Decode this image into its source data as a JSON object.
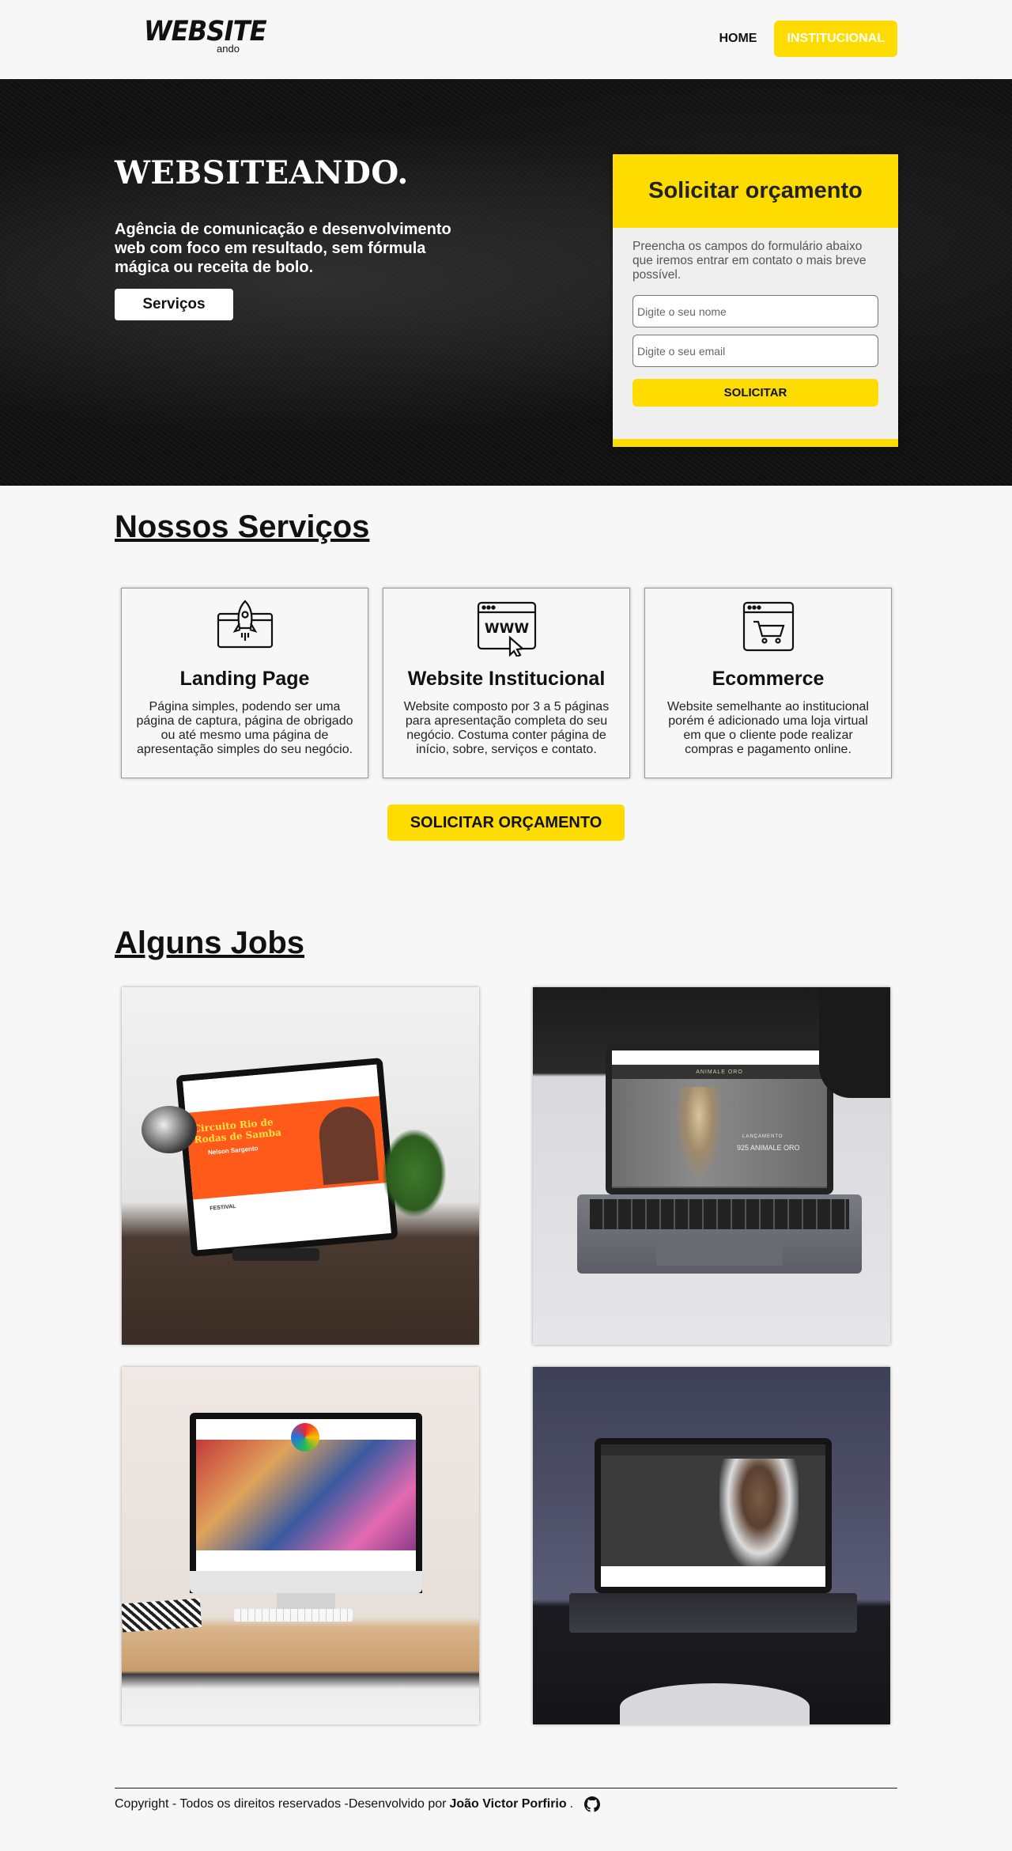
{
  "header": {
    "logo_main": "WEBSITE",
    "logo_sub": "ando",
    "nav": {
      "home": "HOME",
      "institucional": "INSTITUCIONAL"
    }
  },
  "hero": {
    "title": "WEBSITEANDO.",
    "text": "Agência de comunicação e desenvolvimento web com foco em resultado, sem fórmula mágica ou receita de bolo.",
    "button": "Serviços"
  },
  "quote_form": {
    "title": "Solicitar orçamento",
    "description": "Preencha os campos do formulário abaixo que iremos entrar em contato o mais breve possível.",
    "name_placeholder": "Digite o seu nome",
    "email_placeholder": "Digite o seu email",
    "submit": "SOLICITAR"
  },
  "services": {
    "title": "Nossos Serviços",
    "cards": [
      {
        "icon": "rocket-icon",
        "title": "Landing Page",
        "text": "Página simples, podendo ser uma página de captura, página de obrigado ou até mesmo uma página de apresentação simples do seu negócio."
      },
      {
        "icon": "www-browser-icon",
        "title": "Website Institucional",
        "text": "Website composto por 3 a 5 páginas para apresentação completa do seu negócio. Costuma conter página de início, sobre, serviços e contato."
      },
      {
        "icon": "shopping-cart-icon",
        "title": "Ecommerce",
        "text": "Website semelhante ao institucional porém é adicionado uma loja virtual em que o cliente pode realizar compras e pagamento online."
      }
    ],
    "button": "SOLICITAR ORÇAMENTO"
  },
  "jobs": {
    "title": "Alguns Jobs",
    "items": [
      {
        "label": "Circuito Rio de Rodas de Samba"
      },
      {
        "label": "ANIMALE ORO"
      },
      {
        "label": ""
      },
      {
        "label": ""
      }
    ],
    "screen_texts": {
      "job1_headline": "Circuito Rio de Rodas de Samba",
      "job1_sub": "Nelson Sargento",
      "job1_section": "FESTIVAL",
      "job2_brand": "ANIMALE ORO",
      "job2_launch": "LANÇAMENTO",
      "job2_collection": "925 ANIMALE ORO"
    }
  },
  "footer": {
    "text": "Copyright - Todos os direitos reservados -Desenvolvido por",
    "author": "João Victor Porfirio",
    "dot": "."
  }
}
